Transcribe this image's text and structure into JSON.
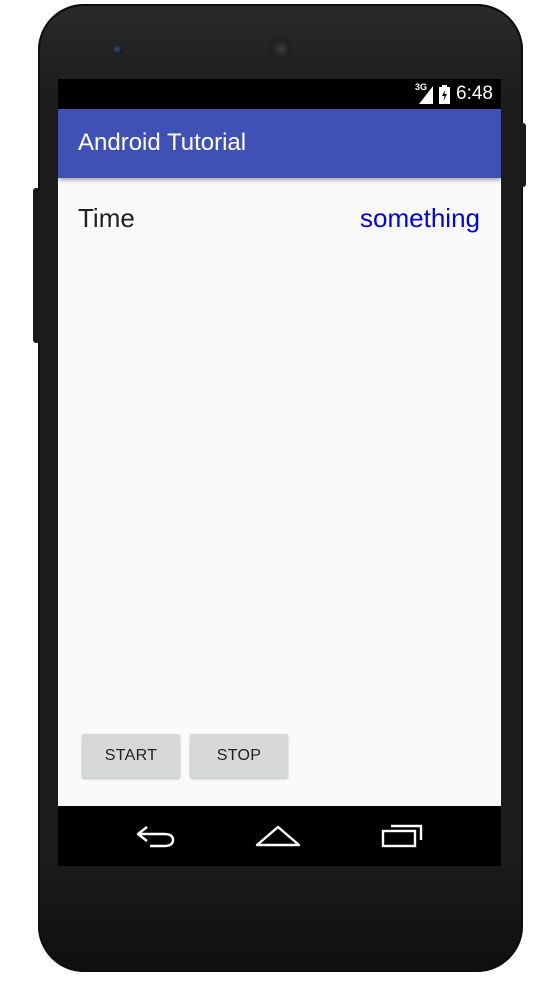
{
  "status_bar": {
    "network_label": "3G",
    "time": "6:48"
  },
  "app_bar": {
    "title": "Android Tutorial"
  },
  "content": {
    "time_label": "Time",
    "time_value": "something"
  },
  "buttons": {
    "start_label": "START",
    "stop_label": "STOP"
  },
  "nav_bar": {
    "icons": [
      "back-icon",
      "home-icon",
      "recents-icon"
    ]
  },
  "colors": {
    "app_bar": "#3f51b5",
    "time_value": "#0000ee",
    "button_bg": "#d6d7d7",
    "screen_bg": "#fafafa"
  }
}
